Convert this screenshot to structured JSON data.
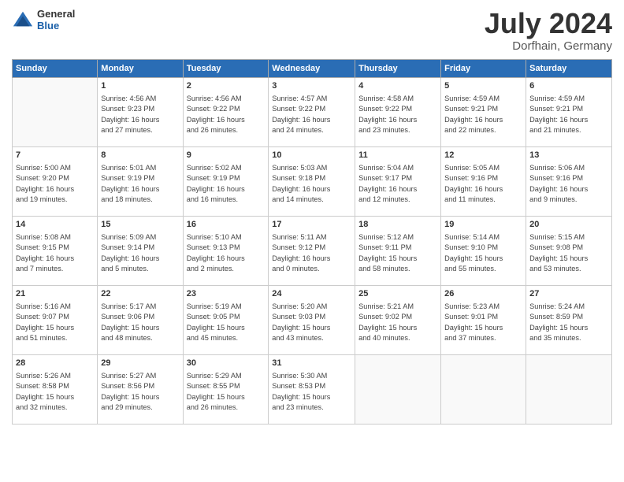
{
  "header": {
    "logo": {
      "general": "General",
      "blue": "Blue"
    },
    "title": "July 2024",
    "location": "Dorfhain, Germany"
  },
  "weekdays": [
    "Sunday",
    "Monday",
    "Tuesday",
    "Wednesday",
    "Thursday",
    "Friday",
    "Saturday"
  ],
  "weeks": [
    [
      {
        "day": "",
        "info": ""
      },
      {
        "day": "1",
        "info": "Sunrise: 4:56 AM\nSunset: 9:23 PM\nDaylight: 16 hours\nand 27 minutes."
      },
      {
        "day": "2",
        "info": "Sunrise: 4:56 AM\nSunset: 9:22 PM\nDaylight: 16 hours\nand 26 minutes."
      },
      {
        "day": "3",
        "info": "Sunrise: 4:57 AM\nSunset: 9:22 PM\nDaylight: 16 hours\nand 24 minutes."
      },
      {
        "day": "4",
        "info": "Sunrise: 4:58 AM\nSunset: 9:22 PM\nDaylight: 16 hours\nand 23 minutes."
      },
      {
        "day": "5",
        "info": "Sunrise: 4:59 AM\nSunset: 9:21 PM\nDaylight: 16 hours\nand 22 minutes."
      },
      {
        "day": "6",
        "info": "Sunrise: 4:59 AM\nSunset: 9:21 PM\nDaylight: 16 hours\nand 21 minutes."
      }
    ],
    [
      {
        "day": "7",
        "info": "Sunrise: 5:00 AM\nSunset: 9:20 PM\nDaylight: 16 hours\nand 19 minutes."
      },
      {
        "day": "8",
        "info": "Sunrise: 5:01 AM\nSunset: 9:19 PM\nDaylight: 16 hours\nand 18 minutes."
      },
      {
        "day": "9",
        "info": "Sunrise: 5:02 AM\nSunset: 9:19 PM\nDaylight: 16 hours\nand 16 minutes."
      },
      {
        "day": "10",
        "info": "Sunrise: 5:03 AM\nSunset: 9:18 PM\nDaylight: 16 hours\nand 14 minutes."
      },
      {
        "day": "11",
        "info": "Sunrise: 5:04 AM\nSunset: 9:17 PM\nDaylight: 16 hours\nand 12 minutes."
      },
      {
        "day": "12",
        "info": "Sunrise: 5:05 AM\nSunset: 9:16 PM\nDaylight: 16 hours\nand 11 minutes."
      },
      {
        "day": "13",
        "info": "Sunrise: 5:06 AM\nSunset: 9:16 PM\nDaylight: 16 hours\nand 9 minutes."
      }
    ],
    [
      {
        "day": "14",
        "info": "Sunrise: 5:08 AM\nSunset: 9:15 PM\nDaylight: 16 hours\nand 7 minutes."
      },
      {
        "day": "15",
        "info": "Sunrise: 5:09 AM\nSunset: 9:14 PM\nDaylight: 16 hours\nand 5 minutes."
      },
      {
        "day": "16",
        "info": "Sunrise: 5:10 AM\nSunset: 9:13 PM\nDaylight: 16 hours\nand 2 minutes."
      },
      {
        "day": "17",
        "info": "Sunrise: 5:11 AM\nSunset: 9:12 PM\nDaylight: 16 hours\nand 0 minutes."
      },
      {
        "day": "18",
        "info": "Sunrise: 5:12 AM\nSunset: 9:11 PM\nDaylight: 15 hours\nand 58 minutes."
      },
      {
        "day": "19",
        "info": "Sunrise: 5:14 AM\nSunset: 9:10 PM\nDaylight: 15 hours\nand 55 minutes."
      },
      {
        "day": "20",
        "info": "Sunrise: 5:15 AM\nSunset: 9:08 PM\nDaylight: 15 hours\nand 53 minutes."
      }
    ],
    [
      {
        "day": "21",
        "info": "Sunrise: 5:16 AM\nSunset: 9:07 PM\nDaylight: 15 hours\nand 51 minutes."
      },
      {
        "day": "22",
        "info": "Sunrise: 5:17 AM\nSunset: 9:06 PM\nDaylight: 15 hours\nand 48 minutes."
      },
      {
        "day": "23",
        "info": "Sunrise: 5:19 AM\nSunset: 9:05 PM\nDaylight: 15 hours\nand 45 minutes."
      },
      {
        "day": "24",
        "info": "Sunrise: 5:20 AM\nSunset: 9:03 PM\nDaylight: 15 hours\nand 43 minutes."
      },
      {
        "day": "25",
        "info": "Sunrise: 5:21 AM\nSunset: 9:02 PM\nDaylight: 15 hours\nand 40 minutes."
      },
      {
        "day": "26",
        "info": "Sunrise: 5:23 AM\nSunset: 9:01 PM\nDaylight: 15 hours\nand 37 minutes."
      },
      {
        "day": "27",
        "info": "Sunrise: 5:24 AM\nSunset: 8:59 PM\nDaylight: 15 hours\nand 35 minutes."
      }
    ],
    [
      {
        "day": "28",
        "info": "Sunrise: 5:26 AM\nSunset: 8:58 PM\nDaylight: 15 hours\nand 32 minutes."
      },
      {
        "day": "29",
        "info": "Sunrise: 5:27 AM\nSunset: 8:56 PM\nDaylight: 15 hours\nand 29 minutes."
      },
      {
        "day": "30",
        "info": "Sunrise: 5:29 AM\nSunset: 8:55 PM\nDaylight: 15 hours\nand 26 minutes."
      },
      {
        "day": "31",
        "info": "Sunrise: 5:30 AM\nSunset: 8:53 PM\nDaylight: 15 hours\nand 23 minutes."
      },
      {
        "day": "",
        "info": ""
      },
      {
        "day": "",
        "info": ""
      },
      {
        "day": "",
        "info": ""
      }
    ]
  ]
}
